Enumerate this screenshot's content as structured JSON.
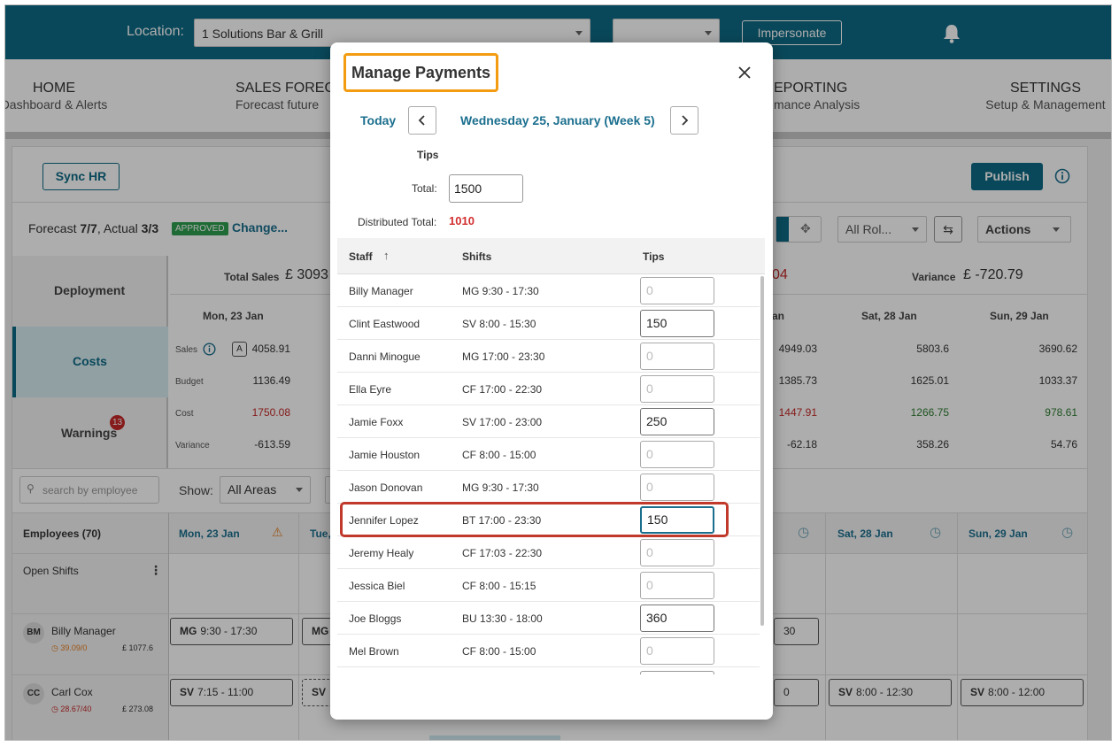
{
  "header": {
    "location_label": "Location:",
    "location_value": "1 Solutions Bar & Grill",
    "second_select_value": "",
    "impersonate_label": "Impersonate",
    "accent_color": "#0e6a85"
  },
  "nav": [
    {
      "title": "HOME",
      "subtitle": "Dashboard & Alerts"
    },
    {
      "title": "SALES FOREC",
      "subtitle": "Forecast future"
    },
    {
      "title": "EPORTING",
      "subtitle": "mance Analysis"
    },
    {
      "title": "SETTINGS",
      "subtitle": "Setup & Management"
    }
  ],
  "toolbar": {
    "sync_hr": "Sync HR",
    "publish": "Publish",
    "forecast_text": "Forecast ",
    "forecast_value": "7/7",
    "actual_text": ",  Actual ",
    "actual_value": "3/3",
    "approved_badge": "APPROVED",
    "change_link": "Change...",
    "all_roles": "All Rol...",
    "actions": "Actions"
  },
  "side_tabs": {
    "deployment": "Deployment",
    "costs": "Costs",
    "warnings": "Warnings",
    "warnings_count": "13"
  },
  "summary": {
    "total_sales_label": "Total Sales",
    "total_sales_value": "£ 3093",
    "partial_value": "04",
    "variance_label": "Variance",
    "variance_value": "£ -720.79"
  },
  "cost_grid": {
    "columns": [
      "Mon, 23 Jan",
      "an",
      "Sat, 28 Jan",
      "Sun, 29 Jan"
    ],
    "row_labels": [
      "Sales",
      "Budget",
      "Cost",
      "Variance"
    ],
    "badge_a": "A",
    "mon": [
      "4058.91",
      "1136.49",
      "1750.08",
      "-613.59"
    ],
    "fri": [
      "4949.03",
      "1385.73",
      "1447.91",
      "-62.18"
    ],
    "sat": [
      "5803.6",
      "1625.01",
      "1266.75",
      "358.26"
    ],
    "sun": [
      "3690.62",
      "1033.37",
      "978.61",
      "54.76"
    ]
  },
  "filters": {
    "search_placeholder": "search by employee",
    "show_label": "Show:",
    "areas_value": "All Areas"
  },
  "schedule": {
    "employees_header": "Employees (70)",
    "open_shifts": "Open Shifts",
    "day_headers": [
      "Mon, 23 Jan",
      "Tue,",
      "Sat, 28 Jan",
      "Sun, 29 Jan"
    ],
    "employees": [
      {
        "initials": "BM",
        "name": "Billy Manager",
        "hours": "39.09/0",
        "cost": "£ 1077.6"
      },
      {
        "initials": "CC",
        "name": "Carl Cox",
        "hours": "28.67/40",
        "cost": "£ 273.08"
      }
    ],
    "shifts_row1": [
      {
        "code": "MG",
        "time": "9:30 - 17:30"
      },
      {
        "code": "MG",
        "time": ""
      },
      {
        "code": "",
        "time": "30"
      }
    ],
    "shifts_row2": [
      {
        "code": "SV",
        "time": "7:15 - 11:00"
      },
      {
        "code": "SV",
        "time": ""
      },
      {
        "code": "",
        "time": "0"
      },
      {
        "code": "SV",
        "time": "8:00 - 12:30"
      },
      {
        "code": "SV",
        "time": "8:00 - 12:00"
      }
    ]
  },
  "modal": {
    "title": "Manage Payments",
    "today": "Today",
    "date": "Wednesday 25, January (Week 5)",
    "tips_label": "Tips",
    "total_label": "Total:",
    "total_value": "1500",
    "distributed_label": "Distributed Total:",
    "distributed_value": "1010",
    "distributed_color": "#d32f2f",
    "col_staff": "Staff",
    "col_shifts": "Shifts",
    "col_tips": "Tips",
    "rows": [
      {
        "name": "Billy Manager",
        "shift": "MG  9:30 - 17:30",
        "tip": "",
        "placeholder": "0"
      },
      {
        "name": "Clint Eastwood",
        "shift": "SV  8:00 - 15:30",
        "tip": "150",
        "placeholder": "0"
      },
      {
        "name": "Danni Minogue",
        "shift": "MG  17:00 - 23:30",
        "tip": "",
        "placeholder": "0"
      },
      {
        "name": "Ella Eyre",
        "shift": "CF  17:00 - 22:30",
        "tip": "",
        "placeholder": "0"
      },
      {
        "name": "Jamie Foxx",
        "shift": "SV  17:00 - 23:00",
        "tip": "250",
        "placeholder": "0"
      },
      {
        "name": "Jamie Houston",
        "shift": "CF  8:00 - 15:00",
        "tip": "",
        "placeholder": "0"
      },
      {
        "name": "Jason Donovan",
        "shift": "MG  9:30 - 17:30",
        "tip": "",
        "placeholder": "0"
      },
      {
        "name": "Jennifer Lopez",
        "shift": "BT  17:00 - 23:30",
        "tip": "150",
        "placeholder": "0"
      },
      {
        "name": "Jeremy Healy",
        "shift": "CF  17:03 - 22:30",
        "tip": "",
        "placeholder": "0"
      },
      {
        "name": "Jessica Biel",
        "shift": "CF  8:00 - 15:15",
        "tip": "",
        "placeholder": "0"
      },
      {
        "name": "Joe Bloggs",
        "shift": "BU  13:30 - 18:00",
        "tip": "360",
        "placeholder": "0"
      },
      {
        "name": "Mel Brown",
        "shift": "CF  8:00 - 15:00",
        "tip": "",
        "placeholder": "0"
      }
    ]
  }
}
